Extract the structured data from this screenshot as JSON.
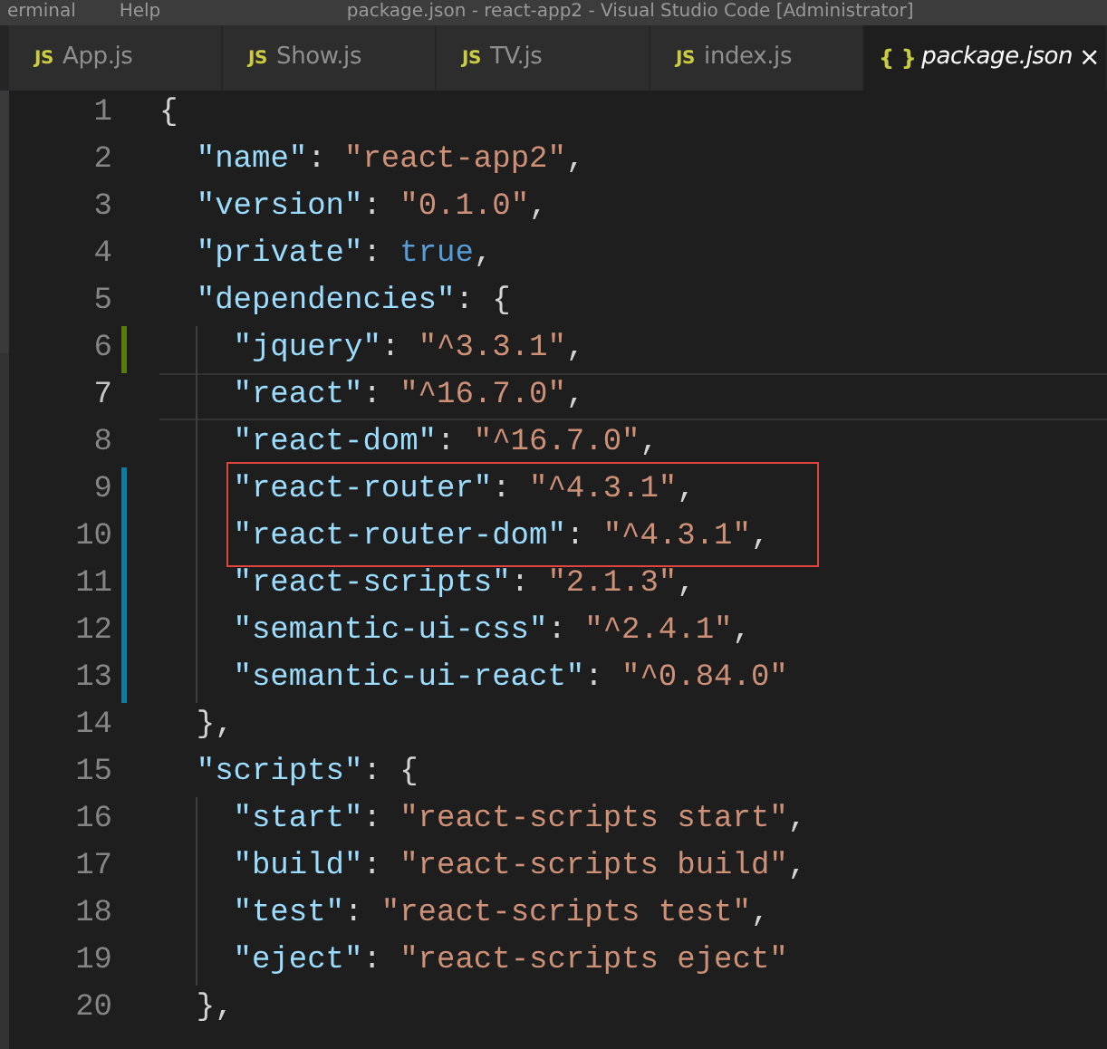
{
  "menu_bar": {
    "items": [
      "erminal",
      "Help"
    ],
    "title": "package.json - react-app2 - Visual Studio Code [Administrator]"
  },
  "tabs": [
    {
      "kind": "js",
      "icon_text": "JS",
      "label": "App.js",
      "selected": false,
      "italic": false
    },
    {
      "kind": "js",
      "icon_text": "JS",
      "label": "Show.js",
      "selected": false,
      "italic": false
    },
    {
      "kind": "js",
      "icon_text": "JS",
      "label": "TV.js",
      "selected": false,
      "italic": false
    },
    {
      "kind": "js",
      "icon_text": "JS",
      "label": "index.js",
      "selected": false,
      "italic": false
    },
    {
      "kind": "json",
      "icon_text": "{ }",
      "label": "package.json",
      "selected": true,
      "italic": true,
      "close": "×"
    }
  ],
  "editor": {
    "lines": [
      {
        "number": "1",
        "current": false,
        "boxed": false,
        "tokens": [
          {
            "kind": "punct",
            "text": "{"
          }
        ],
        "children": [
          {
            "number": "2",
            "current": false,
            "boxed": false,
            "tokens": [
              {
                "kind": "key",
                "text": "\"name\""
              },
              {
                "kind": "punct",
                "text": ": "
              },
              {
                "kind": "string",
                "text": "\"react-app2\""
              },
              {
                "kind": "punct",
                "text": ","
              }
            ]
          },
          {
            "number": "3",
            "current": false,
            "boxed": false,
            "tokens": [
              {
                "kind": "key",
                "text": "\"version\""
              },
              {
                "kind": "punct",
                "text": ": "
              },
              {
                "kind": "string",
                "text": "\"0.1.0\""
              },
              {
                "kind": "punct",
                "text": ","
              }
            ]
          },
          {
            "number": "4",
            "current": false,
            "boxed": false,
            "tokens": [
              {
                "kind": "key",
                "text": "\"private\""
              },
              {
                "kind": "punct",
                "text": ": "
              },
              {
                "kind": "keyword",
                "text": "true"
              },
              {
                "kind": "punct",
                "text": ","
              }
            ]
          },
          {
            "number": "5",
            "current": false,
            "boxed": false,
            "tokens": [
              {
                "kind": "key",
                "text": "\"dependencies\""
              },
              {
                "kind": "punct",
                "text": ": {"
              }
            ],
            "children": [
              {
                "number": "6",
                "current": false,
                "boxed": false,
                "color": "#587c0c",
                "tokens": [
                  {
                    "kind": "key",
                    "text": "\"jquery\""
                  },
                  {
                    "kind": "punct",
                    "text": ": "
                  },
                  {
                    "kind": "string",
                    "text": "\"^3.3.1\""
                  },
                  {
                    "kind": "punct",
                    "text": ","
                  }
                ]
              },
              {
                "number": "7",
                "current": true,
                "boxed": false,
                "tokens": [
                  {
                    "kind": "key",
                    "text": "\"react\""
                  },
                  {
                    "kind": "punct",
                    "text": ": "
                  },
                  {
                    "kind": "string",
                    "text": "\"^16.7.0\""
                  },
                  {
                    "kind": "punct",
                    "text": ","
                  }
                ]
              },
              {
                "number": "8",
                "current": false,
                "boxed": false,
                "tokens": [
                  {
                    "kind": "key",
                    "text": "\"react-dom\""
                  },
                  {
                    "kind": "punct",
                    "text": ": "
                  },
                  {
                    "kind": "string",
                    "text": "\"^16.7.0\""
                  },
                  {
                    "kind": "punct",
                    "text": ","
                  }
                ]
              },
              {
                "number": "9",
                "current": false,
                "boxed": true,
                "color": "#0c7d9d",
                "tokens": [
                  {
                    "kind": "key",
                    "text": "\"react-router\""
                  },
                  {
                    "kind": "punct",
                    "text": ": "
                  },
                  {
                    "kind": "string",
                    "text": "\"^4.3.1\""
                  },
                  {
                    "kind": "punct",
                    "text": ","
                  }
                ]
              },
              {
                "number": "10",
                "current": false,
                "boxed": true,
                "color": "#0c7d9d",
                "tokens": [
                  {
                    "kind": "key",
                    "text": "\"react-router-dom\""
                  },
                  {
                    "kind": "punct",
                    "text": ": "
                  },
                  {
                    "kind": "string",
                    "text": "\"^4.3.1\""
                  },
                  {
                    "kind": "punct",
                    "text": ","
                  }
                ]
              },
              {
                "number": "11",
                "current": false,
                "boxed": false,
                "color": "#0c7d9d",
                "tokens": [
                  {
                    "kind": "key",
                    "text": "\"react-scripts\""
                  },
                  {
                    "kind": "punct",
                    "text": ": "
                  },
                  {
                    "kind": "string",
                    "text": "\"2.1.3\""
                  },
                  {
                    "kind": "punct",
                    "text": ","
                  }
                ]
              },
              {
                "number": "12",
                "current": false,
                "boxed": false,
                "color": "#0c7d9d",
                "tokens": [
                  {
                    "kind": "key",
                    "text": "\"semantic-ui-css\""
                  },
                  {
                    "kind": "punct",
                    "text": ": "
                  },
                  {
                    "kind": "string",
                    "text": "\"^2.4.1\""
                  },
                  {
                    "kind": "punct",
                    "text": ","
                  }
                ]
              },
              {
                "number": "13",
                "current": false,
                "boxed": false,
                "color": "#0c7d9d",
                "tokens": [
                  {
                    "kind": "key",
                    "text": "\"semantic-ui-react\""
                  },
                  {
                    "kind": "punct",
                    "text": ": "
                  },
                  {
                    "kind": "string",
                    "text": "\"^0.84.0\""
                  }
                ]
              }
            ]
          },
          {
            "number": "14",
            "current": false,
            "boxed": false,
            "tokens": [
              {
                "kind": "punct",
                "text": "},"
              }
            ]
          },
          {
            "number": "15",
            "current": false,
            "boxed": false,
            "tokens": [
              {
                "kind": "key",
                "text": "\"scripts\""
              },
              {
                "kind": "punct",
                "text": ": {"
              }
            ],
            "children": [
              {
                "number": "16",
                "current": false,
                "boxed": false,
                "tokens": [
                  {
                    "kind": "key",
                    "text": "\"start\""
                  },
                  {
                    "kind": "punct",
                    "text": ": "
                  },
                  {
                    "kind": "string",
                    "text": "\"react-scripts start\""
                  },
                  {
                    "kind": "punct",
                    "text": ","
                  }
                ]
              },
              {
                "number": "17",
                "current": false,
                "boxed": false,
                "tokens": [
                  {
                    "kind": "key",
                    "text": "\"build\""
                  },
                  {
                    "kind": "punct",
                    "text": ": "
                  },
                  {
                    "kind": "string",
                    "text": "\"react-scripts build\""
                  },
                  {
                    "kind": "punct",
                    "text": ","
                  }
                ]
              },
              {
                "number": "18",
                "current": false,
                "boxed": false,
                "tokens": [
                  {
                    "kind": "key",
                    "text": "\"test\""
                  },
                  {
                    "kind": "punct",
                    "text": ": "
                  },
                  {
                    "kind": "string",
                    "text": "\"react-scripts test\""
                  },
                  {
                    "kind": "punct",
                    "text": ","
                  }
                ]
              },
              {
                "number": "19",
                "current": false,
                "boxed": false,
                "tokens": [
                  {
                    "kind": "key",
                    "text": "\"eject\""
                  },
                  {
                    "kind": "punct",
                    "text": ": "
                  },
                  {
                    "kind": "string",
                    "text": "\"react-scripts eject\""
                  }
                ]
              }
            ]
          },
          {
            "number": "20",
            "current": false,
            "boxed": false,
            "tokens": [
              {
                "kind": "punct",
                "text": "},"
              }
            ]
          }
        ]
      }
    ]
  }
}
